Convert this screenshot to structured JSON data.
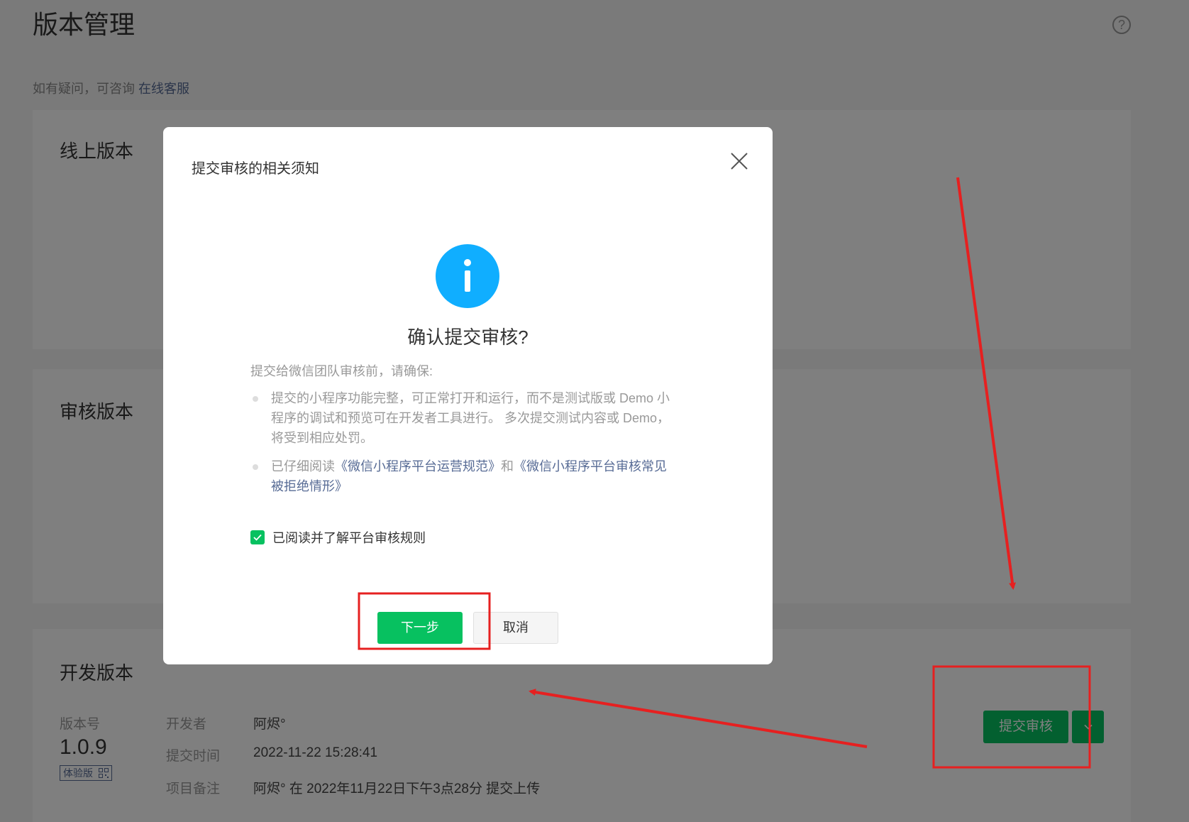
{
  "page": {
    "title": "版本管理",
    "help_text": "如有疑问，可咨询",
    "help_link": "在线客服",
    "help_icon": "?"
  },
  "sections": {
    "online": {
      "title": "线上版本"
    },
    "review": {
      "title": "审核版本"
    },
    "dev": {
      "title": "开发版本",
      "version_label": "版本号",
      "version": "1.0.9",
      "tag": "体验版",
      "developer_label": "开发者",
      "developer": "阿烬°",
      "submit_time_label": "提交时间",
      "submit_time": "2022-11-22 15:28:41",
      "note_label": "项目备注",
      "note": "阿烬° 在 2022年11月22日下午3点28分 提交上传",
      "submit_button": "提交审核"
    }
  },
  "modal": {
    "title": "提交审核的相关须知",
    "confirm_title": "确认提交审核?",
    "lead": "提交给微信团队审核前，请确保:",
    "item1": "提交的小程序功能完整，可正常打开和运行，而不是测试版或 Demo 小程序的调试和预览可在开发者工具进行。 多次提交测试内容或 Demo，将受到相应处罚。",
    "item2_prefix": "已仔细阅读",
    "item2_link1": "《微信小程序平台运营规范》",
    "item2_and": "和",
    "item2_link2": "《微信小程序平台审核常见被拒绝情形》",
    "agree": "已阅读并了解平台审核规则",
    "agree_checked": true,
    "next_button": "下一步",
    "cancel_button": "取消"
  },
  "colors": {
    "accent": "#07c160",
    "info": "#10aeff",
    "link": "#576b95",
    "annotation": "#e62020"
  }
}
